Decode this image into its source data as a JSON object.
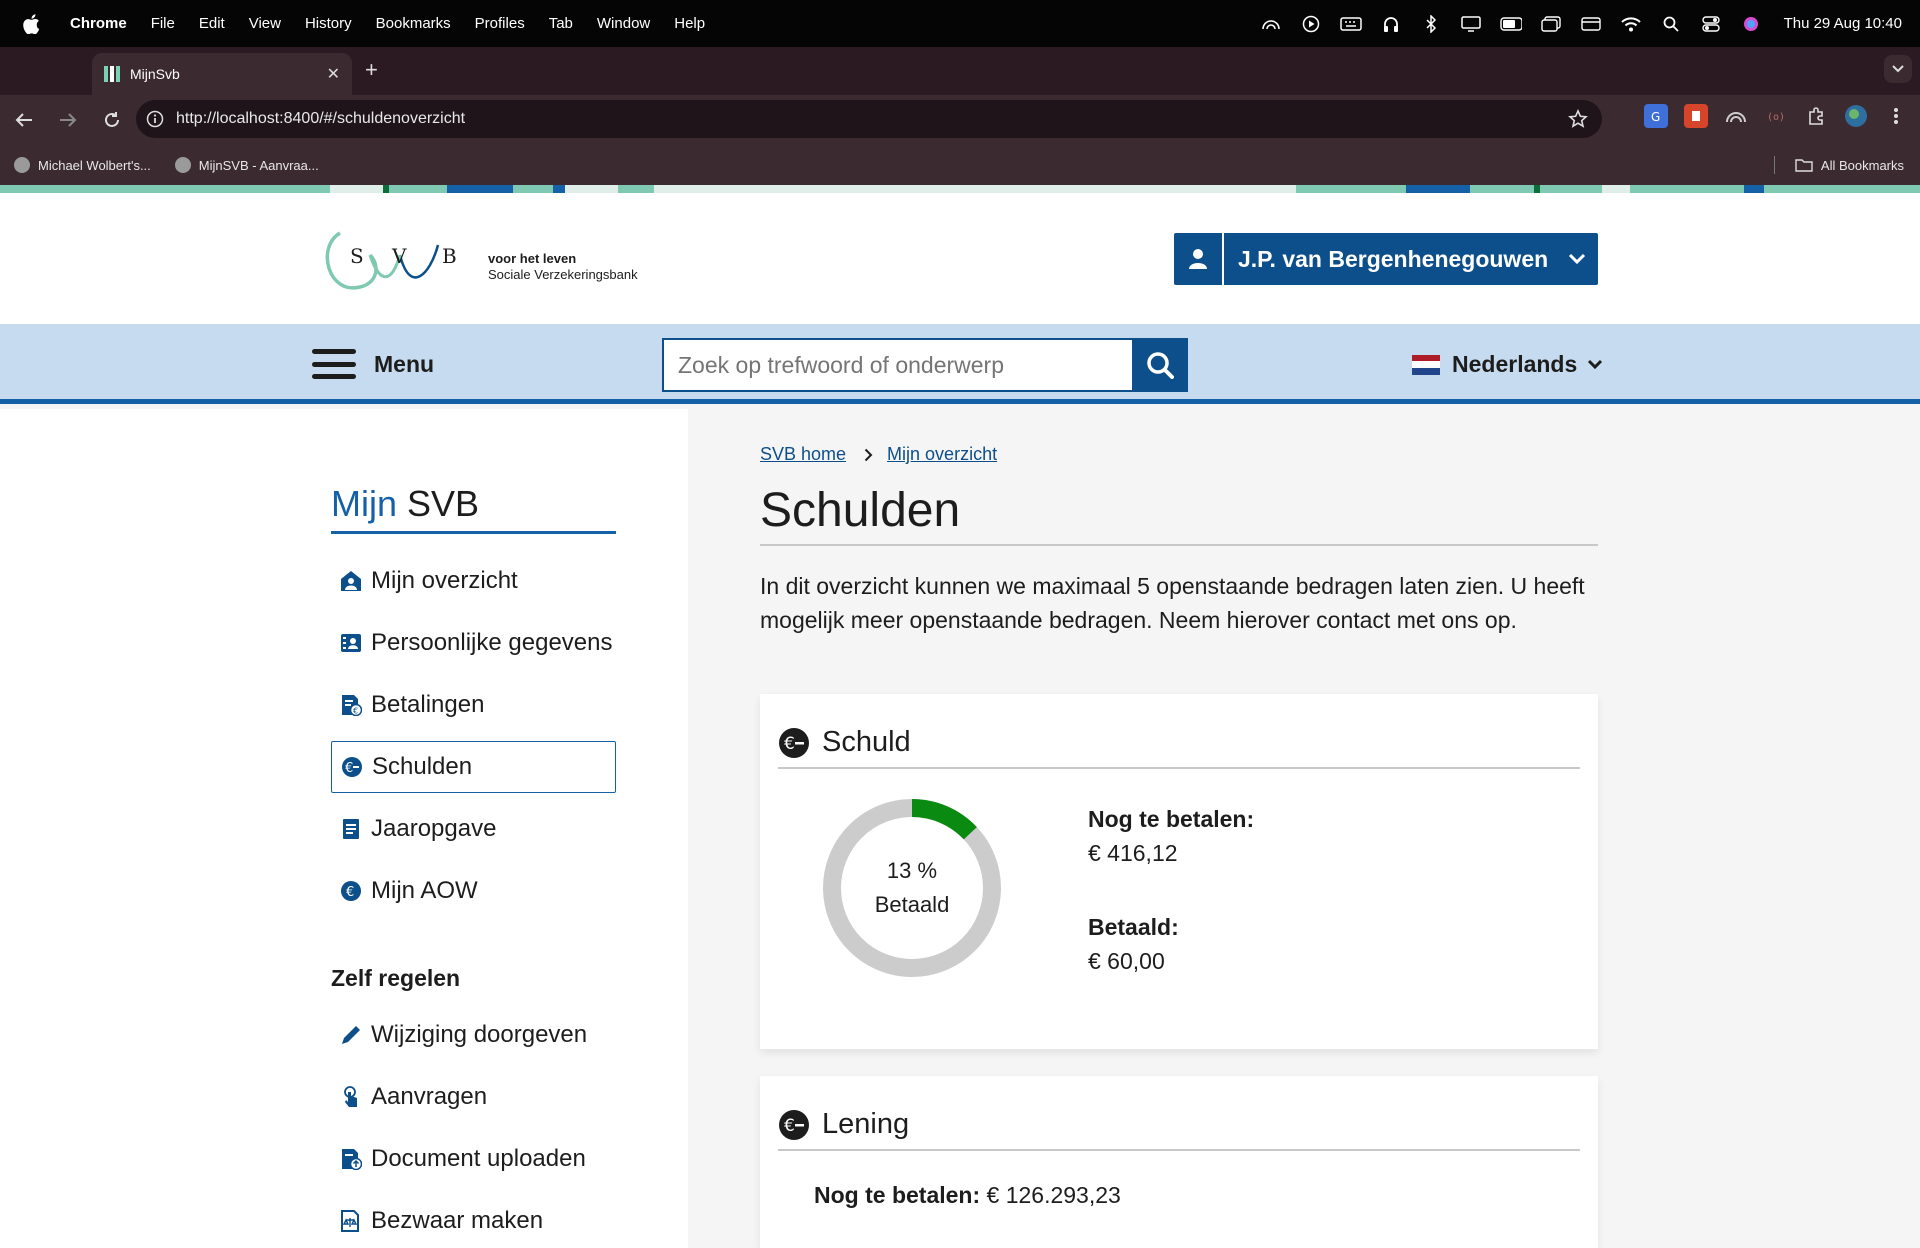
{
  "macos": {
    "menu": [
      "Chrome",
      "File",
      "Edit",
      "View",
      "History",
      "Bookmarks",
      "Profiles",
      "Tab",
      "Window",
      "Help"
    ],
    "clock": "Thu 29 Aug  10:40"
  },
  "browser": {
    "tab_title": "MijnSvb",
    "url": "http://localhost:8400/#/schuldenoverzicht",
    "bookmarks": [
      "Michael Wolbert's...",
      "MijnSVB - Aanvraa..."
    ],
    "all_bookmarks": "All Bookmarks"
  },
  "header": {
    "logo_letters": [
      "S",
      "V",
      "B"
    ],
    "tagline_line1": "voor het leven",
    "tagline_line2": "Sociale Verzekeringsbank",
    "user_name": "J.P. van Bergenhenegouwen"
  },
  "nav": {
    "menu_label": "Menu",
    "search_placeholder": "Zoek op trefwoord of onderwerp",
    "language": "Nederlands"
  },
  "sidebar": {
    "title_prefix": "Mijn",
    "title_suffix": "SVB",
    "items": [
      {
        "label": "Mijn overzicht",
        "icon": "house-person-icon"
      },
      {
        "label": "Persoonlijke gegevens",
        "icon": "id-card-icon"
      },
      {
        "label": "Betalingen",
        "icon": "payment-document-icon"
      },
      {
        "label": "Schulden",
        "icon": "euro-minus-icon",
        "active": true
      },
      {
        "label": "Jaaropgave",
        "icon": "document-icon"
      },
      {
        "label": "Mijn AOW",
        "icon": "euro-circle-icon"
      }
    ],
    "section2_title": "Zelf regelen",
    "items2": [
      {
        "label": "Wijziging doorgeven",
        "icon": "pencil-icon"
      },
      {
        "label": "Aanvragen",
        "icon": "hand-pointer-icon"
      },
      {
        "label": "Document uploaden",
        "icon": "document-upload-icon"
      },
      {
        "label": "Bezwaar maken",
        "icon": "document-scale-icon"
      }
    ]
  },
  "main": {
    "breadcrumb": [
      "SVB home",
      "Mijn overzicht"
    ],
    "title": "Schulden",
    "intro": "In dit overzicht kunnen we maximaal 5 openstaande bedragen laten zien. U heeft mogelijk meer openstaande bedragen. Neem hierover contact met ons op.",
    "cards": [
      {
        "title": "Schuld",
        "progress_percent": 13,
        "progress_line1": "13 %",
        "progress_line2": "Betaald",
        "remaining_label": "Nog te betalen:",
        "remaining_value": "€ 416,12",
        "paid_label": "Betaald:",
        "paid_value": "€ 60,00"
      },
      {
        "title": "Lening",
        "remaining_label": "Nog te betalen:",
        "remaining_value": "€ 126.293,23"
      }
    ]
  },
  "colors": {
    "brand_blue": "#0d4f8b",
    "nav_bg": "#c6dbef",
    "progress_green": "#0a8a10",
    "progress_track": "#cccccc"
  }
}
